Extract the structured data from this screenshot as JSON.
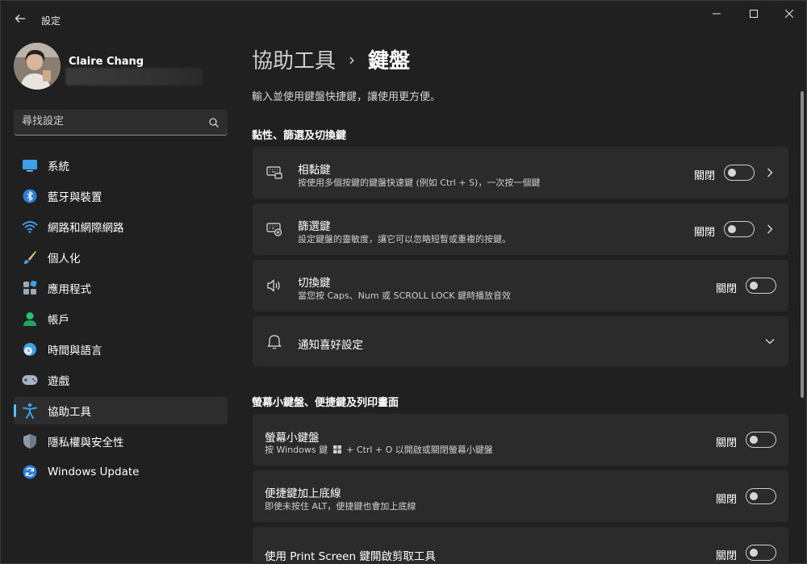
{
  "window": {
    "title": "設定"
  },
  "profile": {
    "name": "Claire Chang"
  },
  "search": {
    "placeholder": "尋找設定"
  },
  "sidebar": {
    "items": [
      {
        "label": "系統",
        "icon": "system-icon"
      },
      {
        "label": "藍牙與裝置",
        "icon": "bluetooth-icon"
      },
      {
        "label": "網路和網際網路",
        "icon": "wifi-icon"
      },
      {
        "label": "個人化",
        "icon": "brush-icon"
      },
      {
        "label": "應用程式",
        "icon": "apps-icon"
      },
      {
        "label": "帳戶",
        "icon": "account-icon"
      },
      {
        "label": "時間與語言",
        "icon": "clock-globe-icon"
      },
      {
        "label": "遊戲",
        "icon": "gamepad-icon"
      },
      {
        "label": "協助工具",
        "icon": "accessibility-icon",
        "selected": true
      },
      {
        "label": "隱私權與安全性",
        "icon": "shield-icon"
      },
      {
        "label": "Windows Update",
        "icon": "update-icon"
      }
    ]
  },
  "header": {
    "parent": "協助工具",
    "separator": "›",
    "current": "鍵盤",
    "description": "輸入並使用鍵盤快捷鍵，讓使用更方便。"
  },
  "sections": {
    "sticky": {
      "title": "黏性、篩選及切換鍵",
      "sticky_keys": {
        "title": "相黏鍵",
        "subtitle": "按使用多個按鍵的鍵盤快速鍵 (例如 Ctrl + S)，一次按一個鍵",
        "state": "關閉"
      },
      "filter_keys": {
        "title": "篩選鍵",
        "subtitle": "設定鍵盤的靈敏度，讓它可以忽略短暫或重複的按鍵。",
        "state": "關閉"
      },
      "toggle_keys": {
        "title": "切換鍵",
        "subtitle": "當您按 Caps、Num 或 SCROLL LOCK 鍵時播放音效",
        "state": "關閉"
      },
      "notifications": {
        "title": "通知喜好設定"
      }
    },
    "onscreen": {
      "title": "螢幕小鍵盤、便捷鍵及列印畫面",
      "osk": {
        "title": "螢幕小鍵盤",
        "subtitle_pre": "按 Windows 鍵",
        "subtitle_post": "+ Ctrl + O 以開啟或關閉螢幕小鍵盤",
        "state": "關閉"
      },
      "underline": {
        "title": "便捷鍵加上底線",
        "subtitle": "即使未按住 ALT，便捷鍵也會加上底線",
        "state": "關閉"
      },
      "print_screen": {
        "title": "使用 Print Screen 鍵開啟剪取工具",
        "state": "關閉"
      }
    }
  },
  "colors": {
    "accent": "#4cc2ff",
    "background": "#202020",
    "card": "#2b2b2b"
  }
}
